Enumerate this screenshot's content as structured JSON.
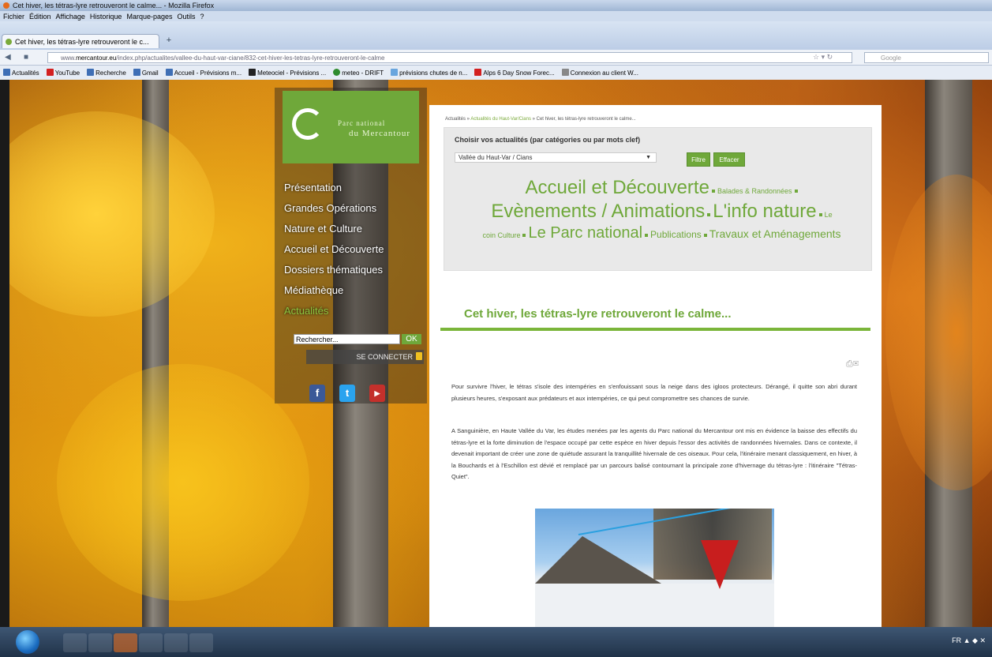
{
  "window": {
    "title": "Cet hiver, les tétras-lyre retrouveront le calme... - Mozilla Firefox"
  },
  "menubar": [
    "Fichier",
    "Édition",
    "Affichage",
    "Historique",
    "Marque-pages",
    "Outils",
    "?"
  ],
  "tab": {
    "label": "Cet hiver, les tétras-lyre retrouveront le c...",
    "new_tab": "+"
  },
  "address": {
    "prefix": "www.",
    "host": "mercantour.eu",
    "path": "/index.php/actualites/vallee-du-haut-var-ciane/832-cet-hiver-les-tetras-lyre-retrouveront-le-calme"
  },
  "search": {
    "placeholder": "Google"
  },
  "bookmarks": [
    {
      "label": "Actualités",
      "color": "#3f6fb5"
    },
    {
      "label": "YouTube",
      "color": "#d32020"
    },
    {
      "label": "Recherche",
      "color": "#3f6fb5"
    },
    {
      "label": "Gmail",
      "color": "#3f6fb5"
    },
    {
      "label": "Accueil - Prévisions m...",
      "color": "#3f6fb5"
    },
    {
      "label": "Meteociel - Prévisions ...",
      "color": "#222"
    },
    {
      "label": "meteo - DRIFT",
      "color": "#2e8b2e"
    },
    {
      "label": "prévisions chutes de n...",
      "color": "#6aa6de"
    },
    {
      "label": "Alps 6 Day Snow Forec...",
      "color": "#d32020"
    },
    {
      "label": "Connexion au client W...",
      "color": "#888"
    }
  ],
  "site": {
    "logo": {
      "line1": "Parc national",
      "line2": "du Mercantour"
    },
    "menu": [
      {
        "label": "Présentation",
        "active": false
      },
      {
        "label": "Grandes Opérations",
        "active": false
      },
      {
        "label": "Nature et Culture",
        "active": false
      },
      {
        "label": "Accueil et Découverte",
        "active": false
      },
      {
        "label": "Dossiers thématiques",
        "active": false
      },
      {
        "label": "Médiathèque",
        "active": false
      },
      {
        "label": "Actualités",
        "active": true
      }
    ],
    "search_value": "Rechercher...",
    "search_button": "OK",
    "connect": "SE CONNECTER",
    "social": [
      {
        "name": "facebook",
        "glyph": "f",
        "color": "#3b5998"
      },
      {
        "name": "twitter",
        "glyph": "t",
        "color": "#2aa3ef"
      },
      {
        "name": "youtube",
        "glyph": "▶",
        "color": "#c4302b"
      }
    ]
  },
  "content": {
    "breadcrumb": {
      "home": "Actualités",
      "section": "Actualités du Haut-Var/Cians",
      "current": "Cet hiver, les tétras-lyre retrouveront le calme..."
    },
    "filter": {
      "title": "Choisir vos actualités (par catégories ou par mots clef)",
      "selected": "Vallée du Haut-Var / Cians",
      "filter_button": "Filtre",
      "clear_button": "Effacer"
    },
    "tags": {
      "accueil": "Accueil et Découverte",
      "balades": "Balades & Randonnées",
      "evenements": "Evènements / Animations",
      "info_nature": "L'info nature",
      "le": "Le",
      "coin_culture": "coin Culture",
      "parc": "Le Parc national",
      "publications": "Publications",
      "travaux": "Travaux et Aménagements"
    },
    "article": {
      "title": "Cet hiver, les tétras-lyre retrouveront le calme...",
      "p1": "Pour survivre l'hiver, le tétras s'isole des intempéries en s'enfouissant sous la neige dans des igloos protecteurs. Dérangé, il quitte son abri durant plusieurs heures, s'exposant aux prédateurs et aux intempéries, ce qui peut compromettre ses chances de survie.",
      "p2": "A Sanguinière, en Haute Vallée du Var, les études menées par les agents du Parc national du Mercantour ont mis en évidence la baisse des effectifs du tétras-lyre et la forte diminution de l'espace occupé par cette espèce en hiver depuis l'essor des activités de randonnées hivernales. Dans ce contexte, il devenait important de créer une zone de quiétude assurant la tranquillité hivernale de ces oiseaux. Pour cela, l'itinéraire menant classiquement, en hiver, à la Bouchards et à l'Eschillon est dévié et remplacé par un parcours balisé contournant la principale zone d'hivernage du tétras-lyre : l'itinéraire \"Tétras-Quiet\"."
    }
  },
  "taskbar": {
    "tray": "FR"
  }
}
